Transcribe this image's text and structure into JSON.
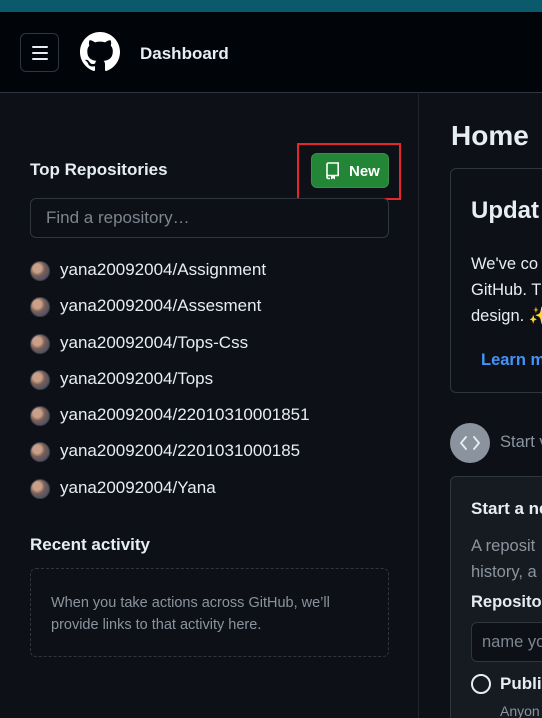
{
  "header": {
    "title": "Dashboard"
  },
  "sidebar": {
    "top_repos_title": "Top Repositories",
    "new_button_label": "New",
    "find_placeholder": "Find a repository…",
    "repos": [
      "yana20092004/Assignment",
      "yana20092004/Assesment",
      "yana20092004/Tops-Css",
      "yana20092004/Tops",
      "yana20092004/22010310001851",
      "yana20092004/2201031000185",
      "yana20092004/Yana"
    ],
    "recent_title": "Recent activity",
    "recent_text": "When you take actions across GitHub, we’ll provide links to that activity here."
  },
  "main": {
    "home_title": "Home",
    "update_title": "Updat",
    "update_lines": [
      "We've co",
      "GitHub. T",
      "design. ✨"
    ],
    "learn_more": "Learn m",
    "start_label": "Start v",
    "new_repo": {
      "title": "Start a ne",
      "desc_lines": [
        "A reposit",
        "history, a"
      ],
      "repo_label": "Repositor",
      "name_placeholder": "name yo",
      "public_label": "Publi",
      "public_sub": "Anyon"
    }
  },
  "colors": {
    "accent_green": "#238636",
    "link_blue": "#4493f8",
    "highlight_red": "#e5262b",
    "top_strip": "#0b5a6b"
  }
}
